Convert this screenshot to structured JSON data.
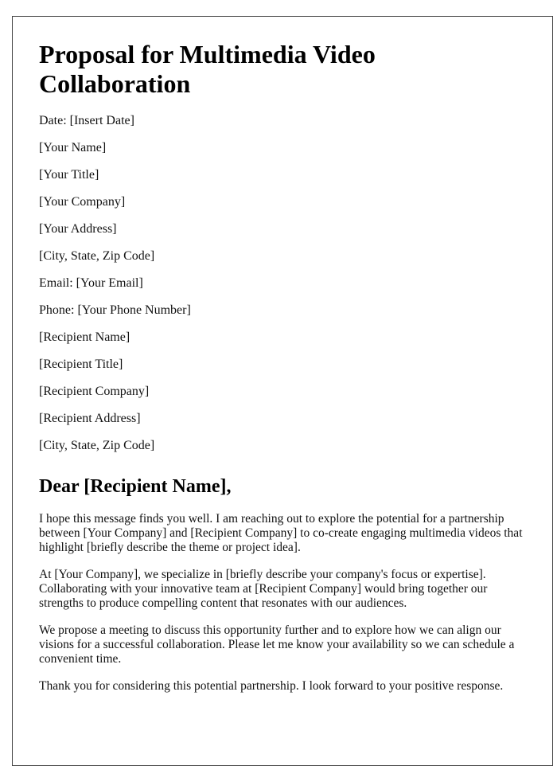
{
  "title": "Proposal for Multimedia Video Collaboration",
  "address_lines": [
    "Date: [Insert Date]",
    "[Your Name]",
    "[Your Title]",
    "[Your Company]",
    "[Your Address]",
    "[City, State, Zip Code]",
    "Email: [Your Email]",
    "Phone: [Your Phone Number]",
    "[Recipient Name]",
    "[Recipient Title]",
    "[Recipient Company]",
    "[Recipient Address]",
    "[City, State, Zip Code]"
  ],
  "salutation": "Dear [Recipient Name],",
  "paragraphs": [
    "I hope this message finds you well. I am reaching out to explore the potential for a partnership between [Your Company] and [Recipient Company] to co-create engaging multimedia videos that highlight [briefly describe the theme or project idea].",
    "At [Your Company], we specialize in [briefly describe your company's focus or expertise]. Collaborating with your innovative team at [Recipient Company] would bring together our strengths to produce compelling content that resonates with our audiences.",
    "We propose a meeting to discuss this opportunity further and to explore how we can align our visions for a successful collaboration. Please let me know your availability so we can schedule a convenient time.",
    "Thank you for considering this potential partnership. I look forward to your positive response."
  ]
}
